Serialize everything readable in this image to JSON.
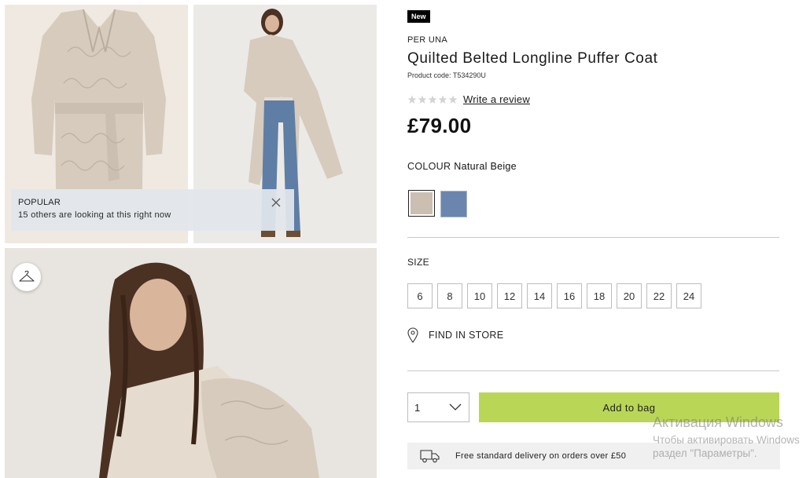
{
  "gallery": {
    "popular": {
      "title": "POPULAR",
      "text": "15 others are looking at this right now",
      "close_icon": "close-icon"
    },
    "hanger_icon": "hanger-icon",
    "colors": {
      "image_bg": "#efe9e1",
      "coat": "#d6cbbd",
      "jeans": "#5e7ea6",
      "hair": "#4a3122"
    }
  },
  "product": {
    "badge": "New",
    "brand": "PER UNA",
    "title": "Quilted Belted Longline Puffer Coat",
    "code": "Product code: T534290U",
    "rating": {
      "stars": 0,
      "max": 5,
      "review_link": "Write a review"
    },
    "price": "£79.00",
    "colour": {
      "label": "COLOUR",
      "value": "Natural Beige",
      "swatches": [
        {
          "name": "Natural Beige",
          "hex": "#cbbfb1",
          "selected": true
        },
        {
          "name": "Blue",
          "hex": "#6b86ae",
          "selected": false
        }
      ]
    },
    "size": {
      "label": "SIZE",
      "options": [
        "6",
        "8",
        "10",
        "12",
        "14",
        "16",
        "18",
        "20",
        "22",
        "24"
      ]
    },
    "find_in_store": "FIND IN STORE",
    "quantity": "1",
    "add_to_bag": "Add to bag",
    "add_to_bag_color": "#bad656",
    "delivery": "Free standard delivery on orders over £50"
  },
  "watermark": {
    "line1": "Активация Windows",
    "line2": "Чтобы активировать Windows",
    "line3": "раздел \"Параметры\"."
  }
}
